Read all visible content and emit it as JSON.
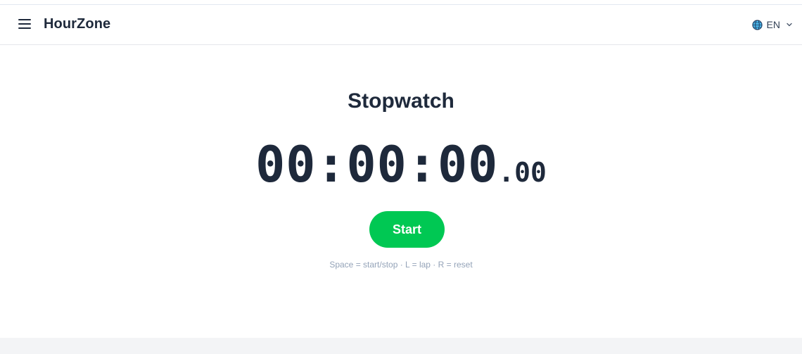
{
  "header": {
    "brand": "HourZone",
    "language": "EN"
  },
  "main": {
    "title": "Stopwatch",
    "time_main": "00:00:00",
    "time_fraction": ".00",
    "start_label": "Start",
    "shortcuts_hint": "Space = start/stop · L = lap · R = reset"
  },
  "colors": {
    "accent_green": "#00c853",
    "text_dark": "#1e293b",
    "hint_gray": "#94a3b8",
    "footer_bg": "#f3f4f6"
  },
  "icons": {
    "menu": "hamburger-menu-icon",
    "language": "globe-icon",
    "dropdown": "chevron-down-icon"
  }
}
